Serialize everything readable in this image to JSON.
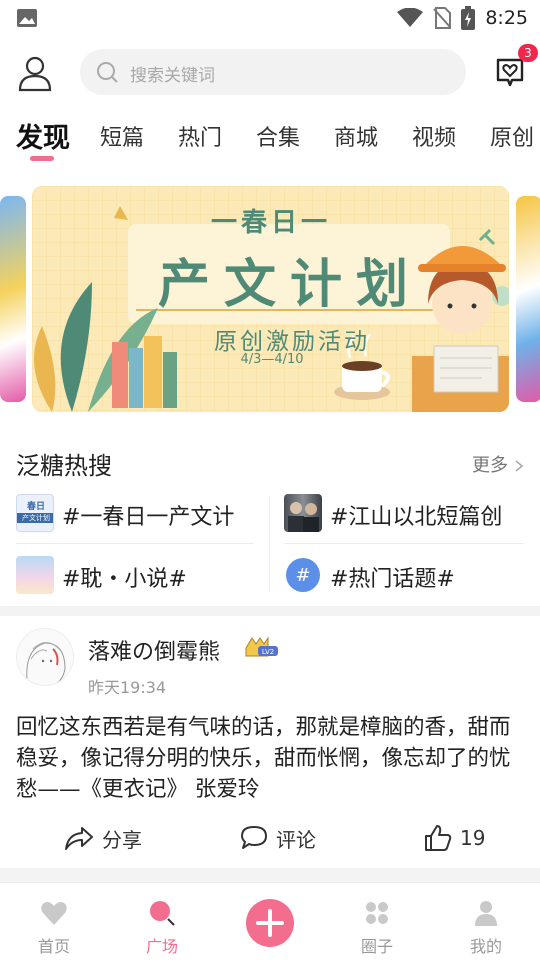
{
  "status_bar": {
    "time": "8:25",
    "icons": [
      "image-notification-icon",
      "wifi-icon",
      "no-sim-icon",
      "battery-charging-icon"
    ]
  },
  "header": {
    "search_placeholder": "搜索关键词",
    "message_badge": "3",
    "icons": [
      "profile-icon",
      "search-icon",
      "message-heart-icon"
    ]
  },
  "tabs": [
    {
      "label": "发现",
      "active": true
    },
    {
      "label": "短篇"
    },
    {
      "label": "热门"
    },
    {
      "label": "合集"
    },
    {
      "label": "商城"
    },
    {
      "label": "视频"
    },
    {
      "label": "原创"
    }
  ],
  "banner": {
    "line1": "一春日一",
    "line2": "产文计划",
    "line3": "原创激励活动",
    "dates": "4/3—4/10"
  },
  "hot_search": {
    "title": "泛糖热搜",
    "more": "更多",
    "thumb_text": [
      "春日",
      "产文计划"
    ],
    "items": [
      {
        "text": "#一春日一产文计"
      },
      {
        "text": "#江山以北短篇创"
      },
      {
        "text": "#耽・小说#"
      },
      {
        "text": "#热门话题#"
      }
    ]
  },
  "post": {
    "username": "落难の倒霉熊",
    "level": "LV2",
    "time": "昨天19:34",
    "content": "回忆这东西若是有气味的话，那就是樟脑的香，甜而稳妥，像记得分明的快乐，甜而怅惘，像忘却了的忧愁——《更衣记》 张爱玲",
    "actions": {
      "share": "分享",
      "comment": "评论",
      "likes": "19"
    }
  },
  "bottom_nav": [
    {
      "label": "首页",
      "icon": "heart-icon"
    },
    {
      "label": "广场",
      "icon": "plaza-icon",
      "active": true
    },
    {
      "label": "",
      "icon": "plus-icon"
    },
    {
      "label": "圈子",
      "icon": "circles-icon"
    },
    {
      "label": "我的",
      "icon": "person-icon"
    }
  ],
  "colors": {
    "accent": "#f36e8e",
    "badge": "#f0264a",
    "banner_bg": "#fbe9b8",
    "banner_title": "#4f8a76"
  }
}
